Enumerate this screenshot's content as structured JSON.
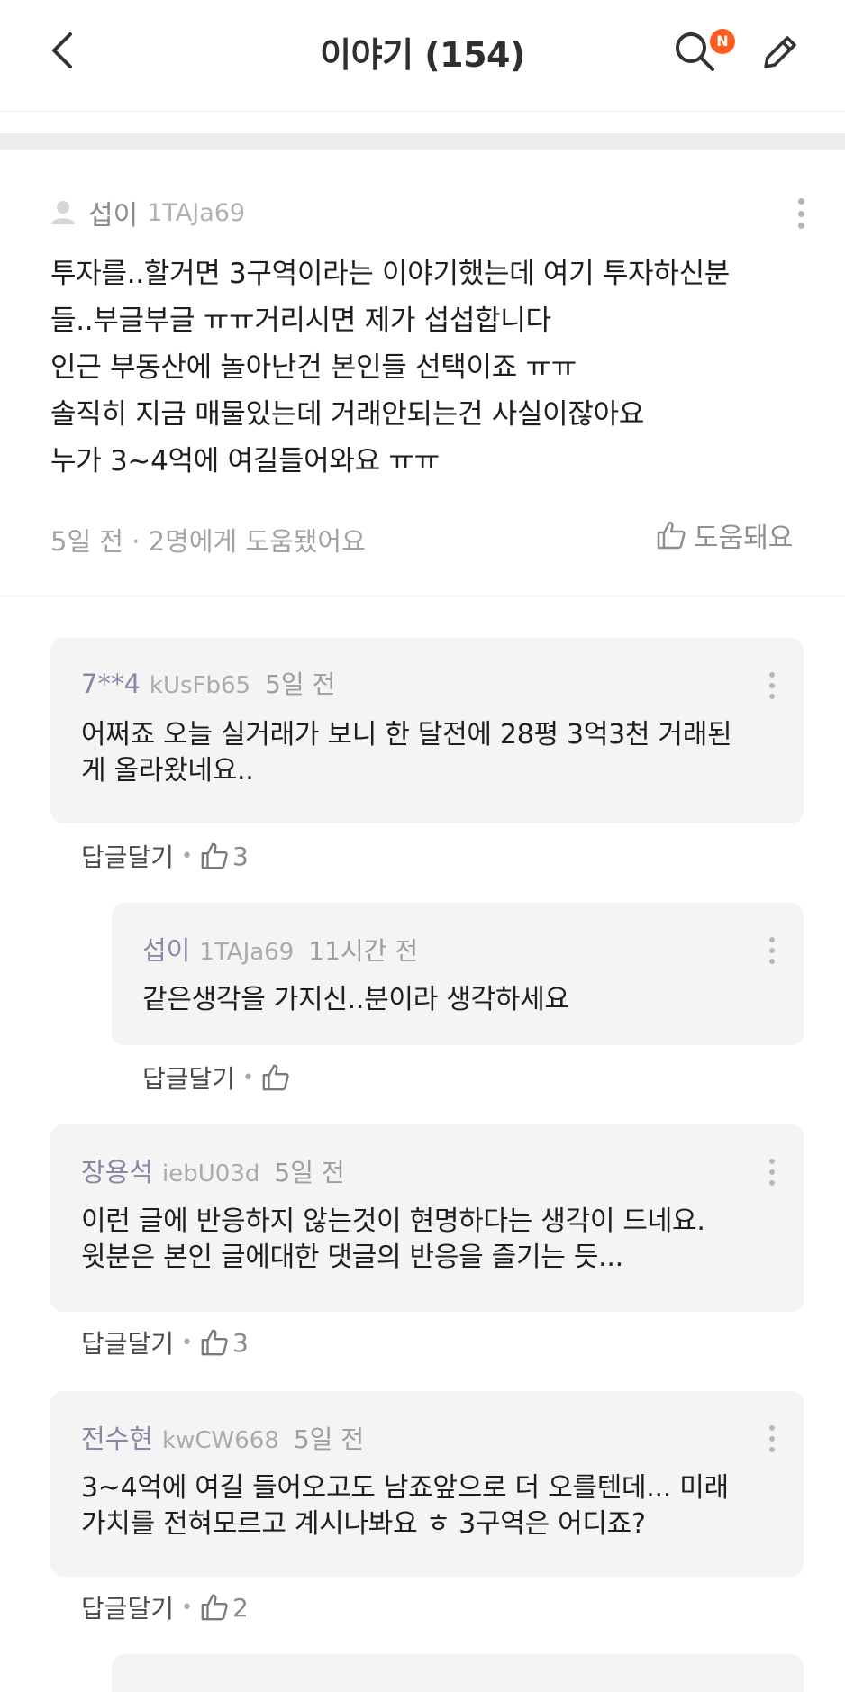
{
  "header": {
    "title": "이야기 (154)",
    "search_badge": "N",
    "accent_color": "#ff5a1f"
  },
  "post": {
    "author_name": "섭이",
    "author_id": "1TAJa69",
    "lines": [
      "투자를..할거면 3구역이라는 이야기했는데 여기 투자하신분",
      "들..부글부글 ㅠㅠ거리시면 제가 섭섭합니다",
      "인근 부동산에 놀아난건 본인들 선택이죠 ㅠㅠ",
      "솔직히 지금 매물있는데 거래안되는건 사실이잖아요",
      "누가 3~4억에 여길들어와요 ㅠㅠ"
    ],
    "meta": "5일 전 · 2명에게 도움됐어요",
    "helpful_label": "도움돼요"
  },
  "comments": [
    {
      "name": "7**4",
      "id": "kUsFb65",
      "time": "5일 전",
      "lines": [
        "어쩌죠 오늘 실거래가 보니 한 달전에 28평 3억3천 거래된",
        "게 올라왔네요.."
      ],
      "reply_label": "답글달기",
      "likes": "3"
    },
    {
      "name": "섭이",
      "id": "1TAJa69",
      "time": "11시간 전",
      "lines": [
        "같은생각을 가지신..분이라 생각하세요"
      ],
      "reply_label": "답글달기",
      "likes": ""
    },
    {
      "name": "장용석",
      "id": "iebU03d",
      "time": "5일 전",
      "lines": [
        "이런 글에 반응하지 않는것이 현명하다는 생각이 드네요.",
        "윗분은 본인 글에대한 댓글의 반응을 즐기는 듯..."
      ],
      "reply_label": "답글달기",
      "likes": "3"
    },
    {
      "name": "전수현",
      "id": "kwCW668",
      "time": "5일 전",
      "lines": [
        "3~4억에 여길 들어오고도 남죠앞으로 더 오를텐데... 미래",
        "가치를 전혀모르고 계시나봐요 ㅎ 3구역은 어디죠?"
      ],
      "reply_label": "답글달기",
      "likes": "2"
    }
  ]
}
